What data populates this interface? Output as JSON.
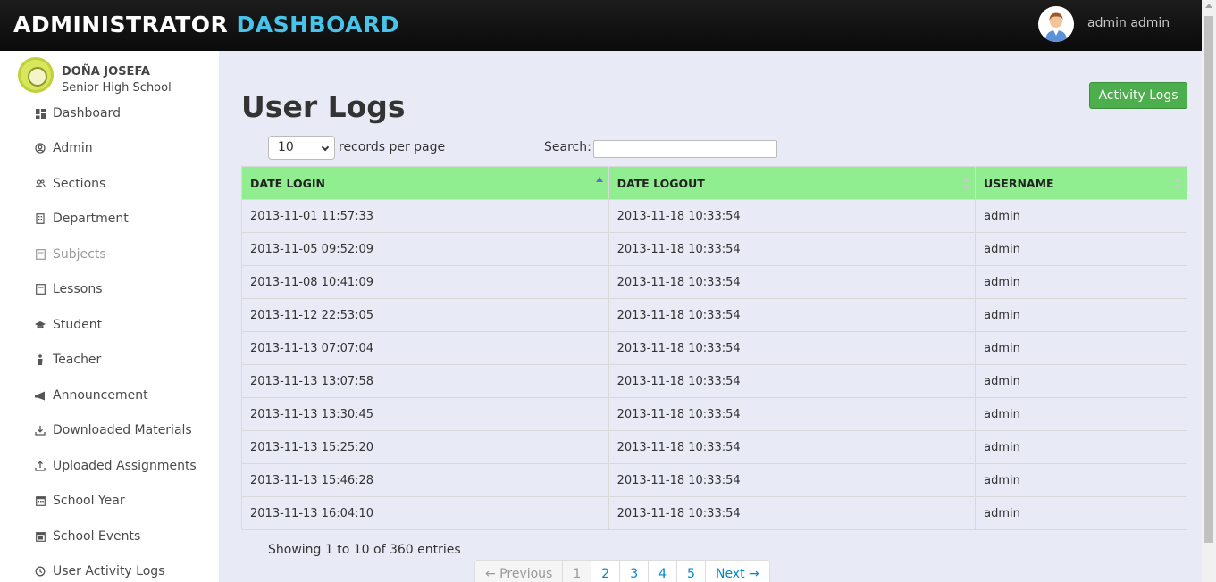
{
  "header": {
    "title_main": "ADMINISTRATOR",
    "title_accent": "DASHBOARD",
    "username": "admin admin"
  },
  "sidebar": {
    "school_line1": "DOÑA JOSEFA",
    "school_line2": "Senior High School",
    "items": [
      {
        "label": "Dashboard",
        "icon": "dashboard-icon"
      },
      {
        "label": "Admin",
        "icon": "user-circle-icon"
      },
      {
        "label": "Sections",
        "icon": "users-icon"
      },
      {
        "label": "Department",
        "icon": "building-icon"
      },
      {
        "label": "Subjects",
        "icon": "book-icon"
      },
      {
        "label": "Lessons",
        "icon": "book-icon"
      },
      {
        "label": "Student",
        "icon": "graduation-cap-icon"
      },
      {
        "label": "Teacher",
        "icon": "teacher-icon"
      },
      {
        "label": "Announcement",
        "icon": "megaphone-icon"
      },
      {
        "label": "Downloaded Materials",
        "icon": "download-icon"
      },
      {
        "label": "Uploaded Assignments",
        "icon": "upload-icon"
      },
      {
        "label": "School Year",
        "icon": "calendar-icon"
      },
      {
        "label": "School Events",
        "icon": "calendar-icon"
      },
      {
        "label": "User Activity Logs",
        "icon": "history-icon"
      }
    ]
  },
  "main": {
    "page_title": "User Logs",
    "activity_button": "Activity Logs",
    "length_value": "10",
    "length_label": "records per page",
    "search_label": "Search:",
    "search_value": "",
    "columns": [
      "DATE LOGIN",
      "DATE LOGOUT",
      "USERNAME"
    ],
    "rows": [
      [
        "2013-11-01 11:57:33",
        "2013-11-18 10:33:54",
        "admin"
      ],
      [
        "2013-11-05 09:52:09",
        "2013-11-18 10:33:54",
        "admin"
      ],
      [
        "2013-11-08 10:41:09",
        "2013-11-18 10:33:54",
        "admin"
      ],
      [
        "2013-11-12 22:53:05",
        "2013-11-18 10:33:54",
        "admin"
      ],
      [
        "2013-11-13 07:07:04",
        "2013-11-18 10:33:54",
        "admin"
      ],
      [
        "2013-11-13 13:07:58",
        "2013-11-18 10:33:54",
        "admin"
      ],
      [
        "2013-11-13 13:30:45",
        "2013-11-18 10:33:54",
        "admin"
      ],
      [
        "2013-11-13 15:25:20",
        "2013-11-18 10:33:54",
        "admin"
      ],
      [
        "2013-11-13 15:46:28",
        "2013-11-18 10:33:54",
        "admin"
      ],
      [
        "2013-11-13 16:04:10",
        "2013-11-18 10:33:54",
        "admin"
      ]
    ],
    "info": "Showing 1 to 10 of 360 entries",
    "pagination": {
      "previous": "← Previous",
      "pages": [
        "1",
        "2",
        "3",
        "4",
        "5"
      ],
      "next": "Next →",
      "current": "1"
    }
  },
  "colors": {
    "header_bg": "#111111",
    "accent": "#48c3ea",
    "table_header": "#90ee90",
    "button_green": "#4cae4c",
    "content_bg": "#e8eaf6"
  }
}
